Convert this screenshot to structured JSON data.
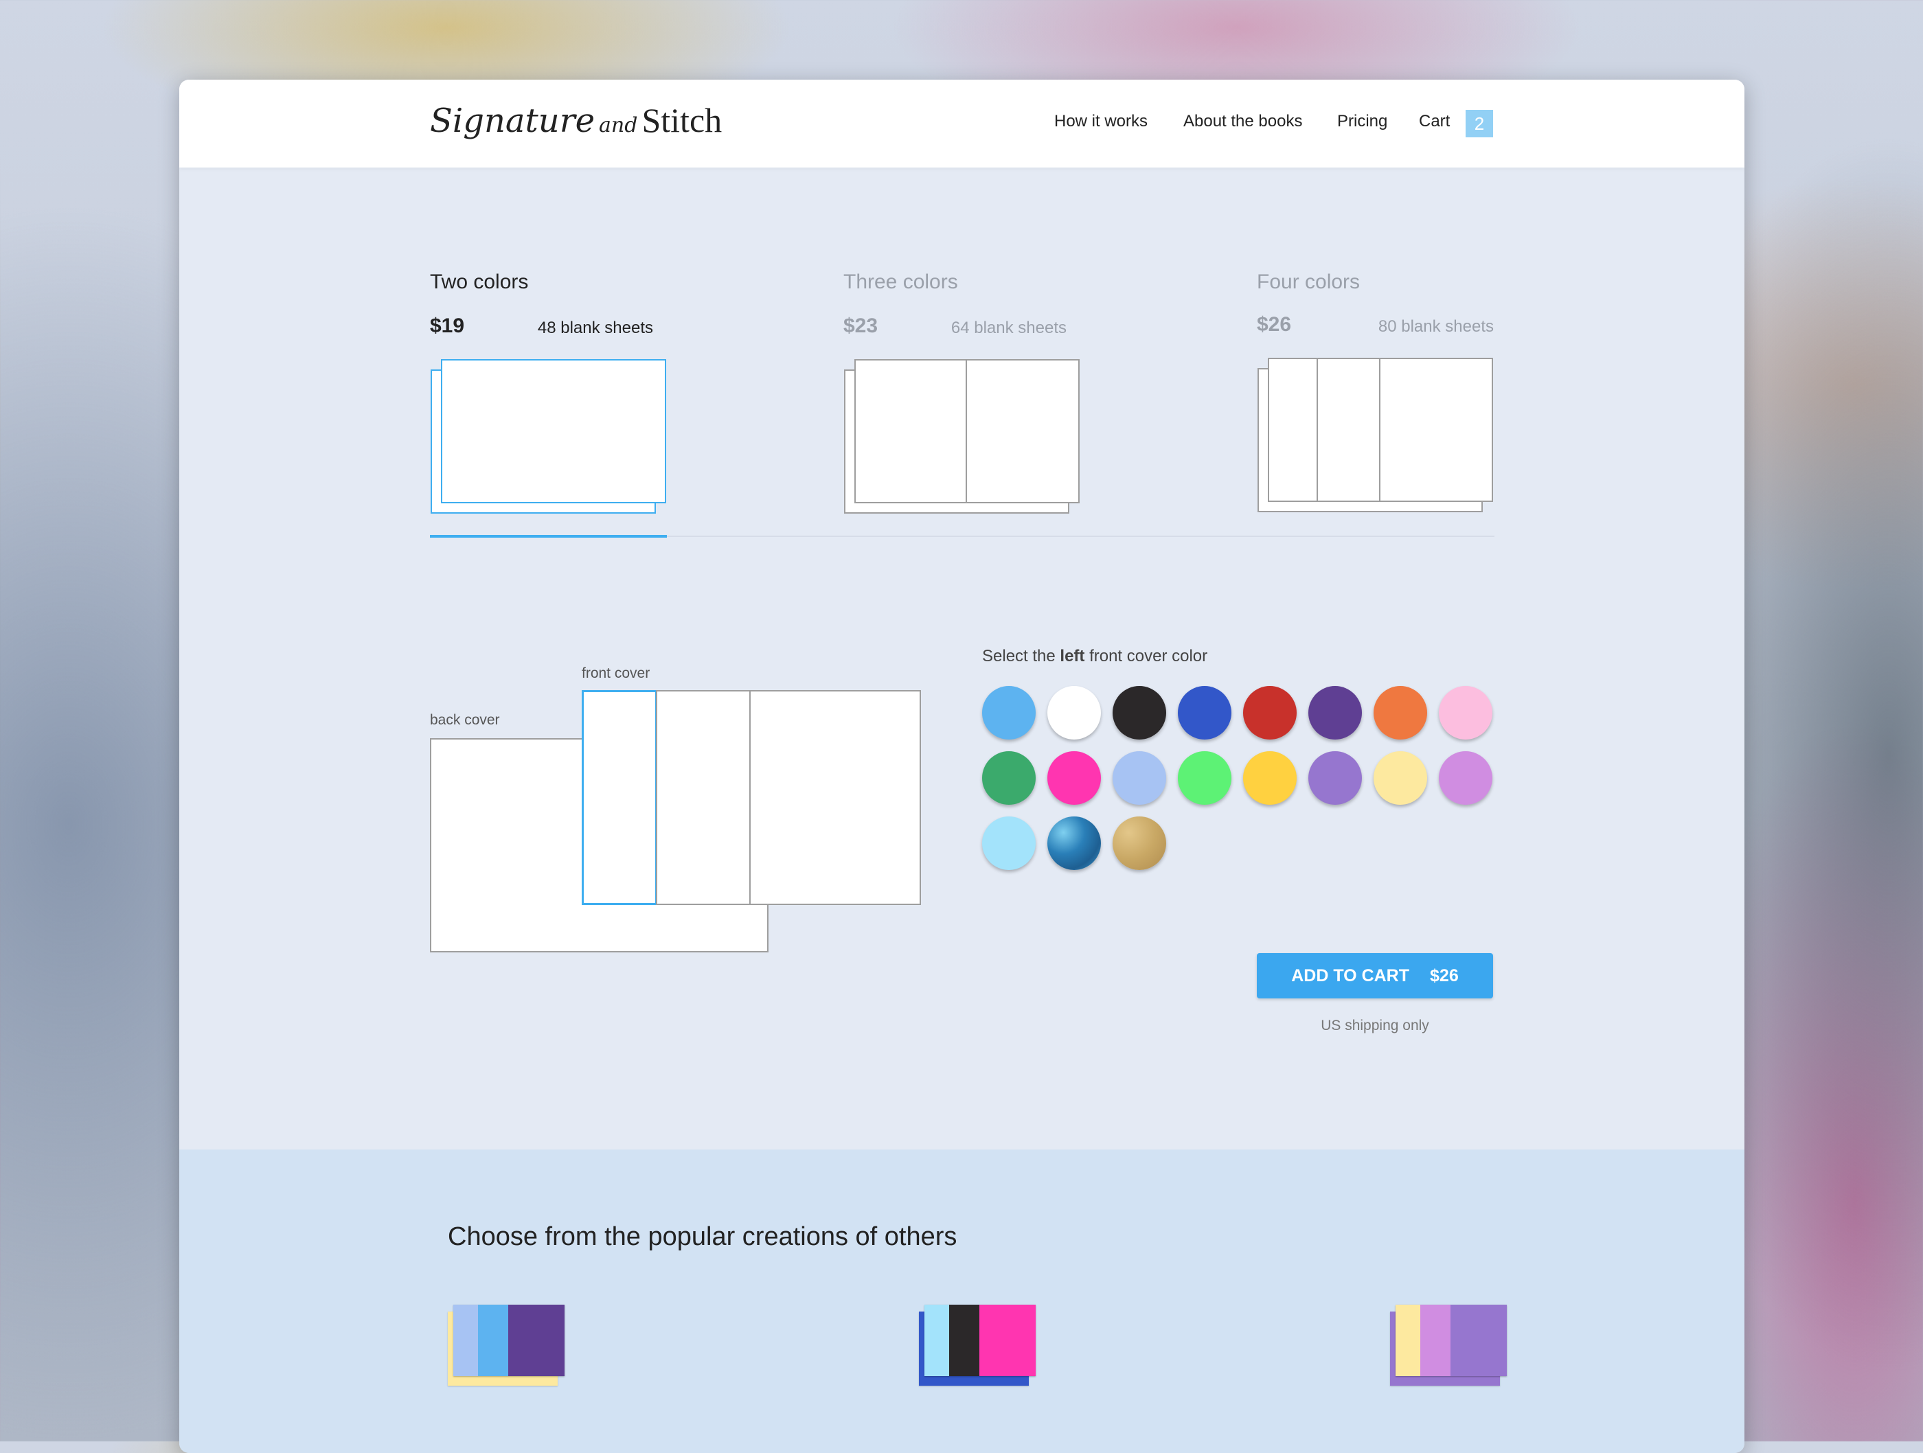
{
  "brand": {
    "signature": "Signature",
    "and": "and",
    "stitch": "Stitch"
  },
  "nav": {
    "how": "How it works",
    "about": "About the books",
    "pricing": "Pricing",
    "cart": "Cart",
    "cart_count": "2"
  },
  "tiers": [
    {
      "title": "Two colors",
      "price": "$19",
      "sheets": "48 blank sheets"
    },
    {
      "title": "Three colors",
      "price": "$23",
      "sheets": "64 blank sheets"
    },
    {
      "title": "Four colors",
      "price": "$26",
      "sheets": "80 blank sheets"
    }
  ],
  "selected_tier": "Two colors",
  "preview": {
    "back_cover": "back cover",
    "front_cover": "front cover"
  },
  "picker": {
    "prefix": "Select the ",
    "bold": "left",
    "suffix": " front cover color"
  },
  "swatches": [
    "#5db3f0",
    "#ffffff",
    "#2b2829",
    "#3257c9",
    "#c8312b",
    "#5f3f93",
    "#ef7840",
    "#fcbedf",
    "#3baa6c",
    "#ff35b0",
    "#a7c3f3",
    "#5df275",
    "#ffd140",
    "#9676cf",
    "#fde99f",
    "#d08de1",
    "#a3e3fb",
    "glitter-blue",
    "glitter-gold"
  ],
  "add_to_cart": {
    "label": "ADD TO CART",
    "price": "$26"
  },
  "shipping_note": "US shipping only",
  "popular": {
    "title": "Choose from the popular creations of others",
    "items": [
      {
        "back": "#fde99f",
        "front": [
          "#a7c3f3",
          "#5db3f0",
          "#5f3f93"
        ]
      },
      {
        "back": "#3257c9",
        "front": [
          "#a3e3fb",
          "#2b2829",
          "#ff35b0"
        ]
      },
      {
        "back": "#9676cf",
        "front": [
          "#fde99f",
          "#d08de1",
          "#9676cf"
        ]
      }
    ]
  },
  "colors": {
    "accent": "#3ba7ef",
    "page_bg": "#e4eaf4",
    "popular_bg": "#d2e2f3"
  }
}
